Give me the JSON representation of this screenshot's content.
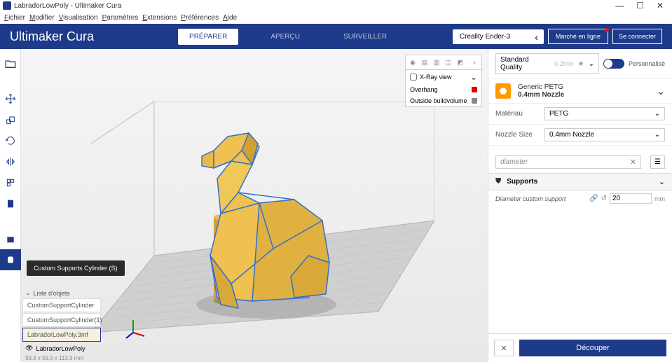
{
  "window": {
    "title": "LabradorLowPoly - Ultimaker Cura"
  },
  "menu": {
    "file": "Fichier",
    "edit": "Modifier",
    "view": "Visualisation",
    "settings": "Paramètres",
    "extensions": "Extensions",
    "preferences": "Préférences",
    "help": "Aide"
  },
  "navbar": {
    "brand1": "Ultimaker",
    "brand2": " Cura",
    "stages": {
      "prepare": "PRÉPARER",
      "preview": "APERÇU",
      "monitor": "SURVEILLER"
    },
    "printer": "Creality Ender-3",
    "market": "Marché en ligne",
    "connect": "Se connecter"
  },
  "tooltip": "Custom Supports Cylinder (S)",
  "view_panel": {
    "xray": "X-Ray view",
    "overhang": "Overhang",
    "outside": "Outside buildvolume"
  },
  "objects": {
    "header": "Liste d'objets",
    "items": [
      "CustomSupportCylinder",
      "CustomSupportCylinder(1)",
      "LabradorLowPoly.3mf"
    ],
    "footer_name": "LabradorLowPoly",
    "dims": "99.9 x 59.0 x 113.3 mm"
  },
  "panel": {
    "profile": {
      "name": "Standard Quality",
      "sub": "0.2mm"
    },
    "custom_label": "Personnalisé",
    "material": {
      "line1": "Generic PETG",
      "line2": "0.4mm Nozzle"
    },
    "material_label": "Matériau",
    "material_value": "PETG",
    "nozzle_label": "Nozzle Size",
    "nozzle_value": "0.4mm Nozzle",
    "search_value": "diameter",
    "category": "Supports",
    "setting": {
      "label": "Diameter custom support",
      "value": "20",
      "unit": "mm"
    },
    "slice": "Découper"
  }
}
